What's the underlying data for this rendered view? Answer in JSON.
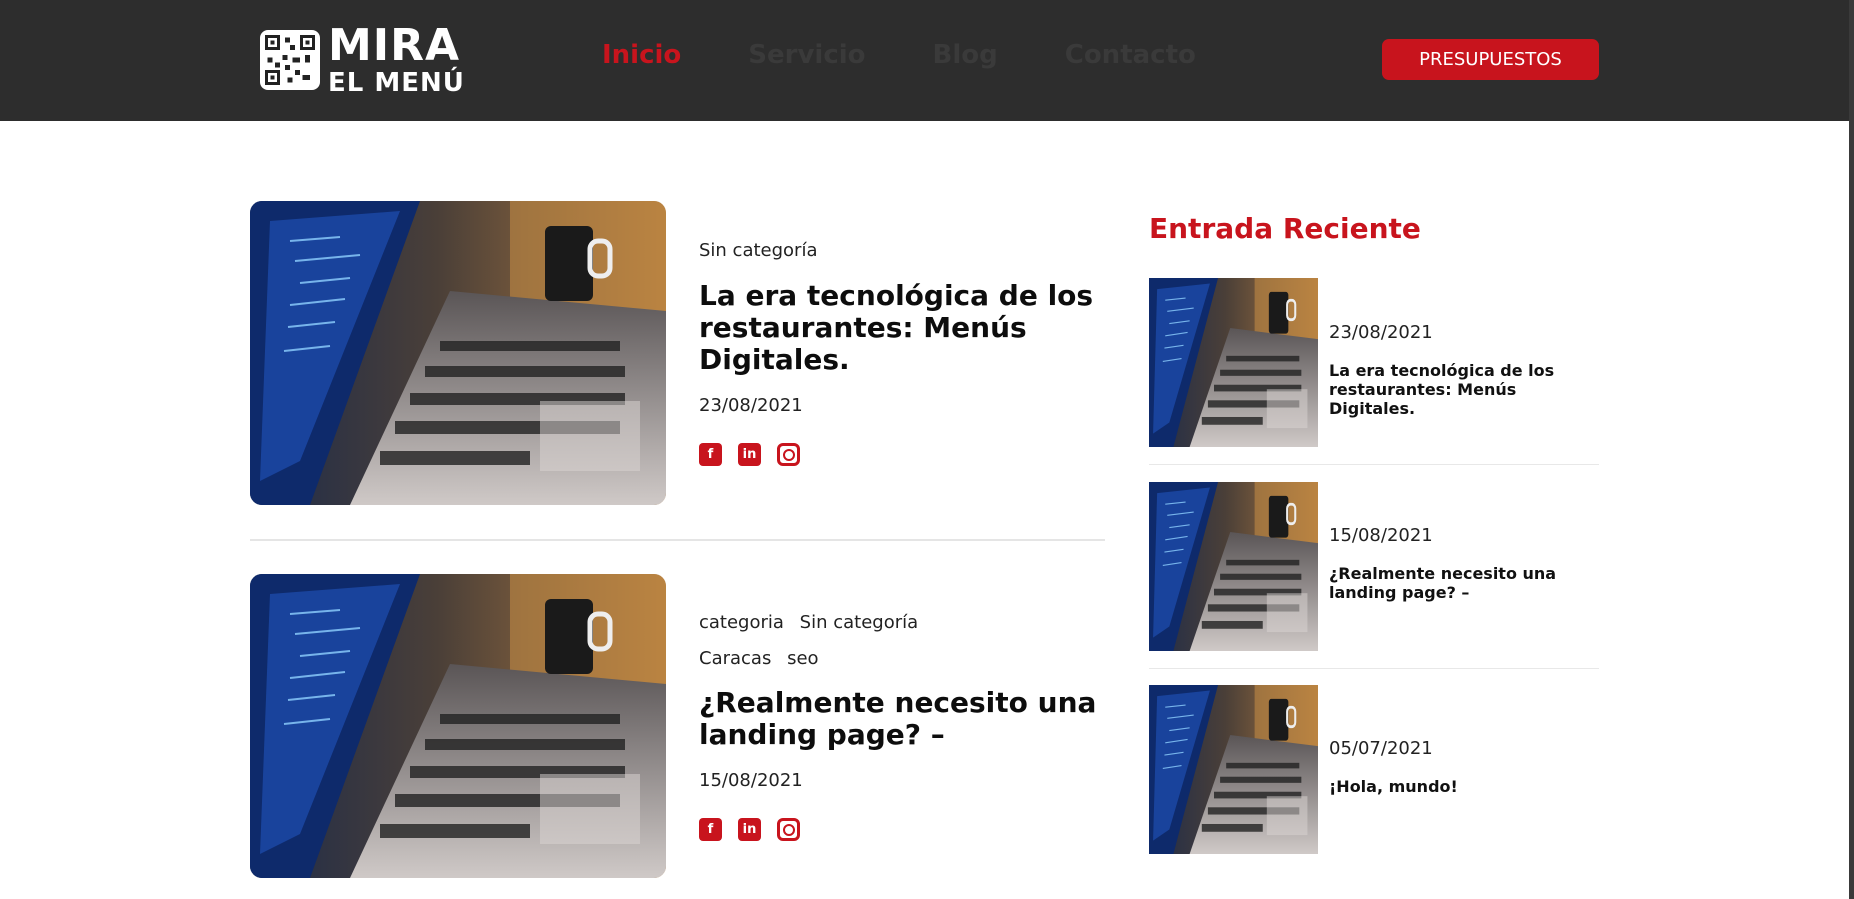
{
  "brand": {
    "line1": "MIRA",
    "line2": "EL MENÚ"
  },
  "nav": {
    "items": [
      {
        "label": "Inicio",
        "active": true
      },
      {
        "label": "Servicio",
        "active": false
      },
      {
        "label": "Blog",
        "active": false
      },
      {
        "label": "Contacto",
        "active": false
      }
    ],
    "cta_label": "PRESUPUESTOS"
  },
  "posts": [
    {
      "categories": [
        "Sin categoría"
      ],
      "tags": [],
      "title": "La era tecnológica de los restaurantes: Menús Digitales.",
      "date": "23/08/2021"
    },
    {
      "categories": [
        "categoria",
        "Sin categoría"
      ],
      "tags": [
        "Caracas",
        "seo"
      ],
      "title": "¿Realmente necesito una landing page? –",
      "date": "15/08/2021"
    }
  ],
  "social_icons": [
    "facebook-icon",
    "linkedin-icon",
    "instagram-icon"
  ],
  "sidebar": {
    "title": "Entrada Reciente",
    "items": [
      {
        "date": "23/08/2021",
        "title": "La era tecnológica de los restaurantes: Menús Digitales."
      },
      {
        "date": "15/08/2021",
        "title": "¿Realmente necesito una landing page? –"
      },
      {
        "date": "05/07/2021",
        "title": "¡Hola, mundo!"
      }
    ]
  },
  "colors": {
    "accent": "#c8141d",
    "header_bg": "#2d2d2d"
  }
}
